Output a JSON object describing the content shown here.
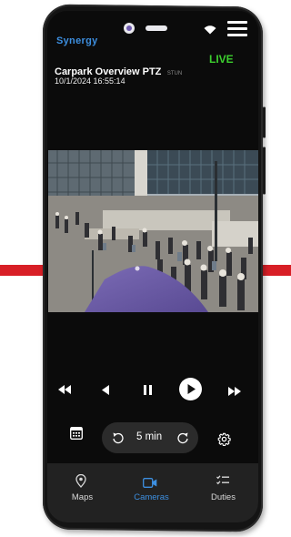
{
  "app": {
    "brand": "Synergy"
  },
  "camera": {
    "name": "Carpark Overview PTZ",
    "badge": "STUN",
    "timestamp": "10/1/2024 16:55:14",
    "status": "LIVE"
  },
  "playback": {
    "interval_label": "5 min"
  },
  "nav": {
    "items": [
      {
        "label": "Maps",
        "icon": "map-pin-icon",
        "active": false
      },
      {
        "label": "Cameras",
        "icon": "video-camera-icon",
        "active": true
      },
      {
        "label": "Duties",
        "icon": "duties-list-icon",
        "active": false
      }
    ]
  },
  "colors": {
    "accent": "#3d8fe0",
    "live": "#3ccf2e",
    "stripe": "#d81f26",
    "background": "#0b0b0b"
  }
}
